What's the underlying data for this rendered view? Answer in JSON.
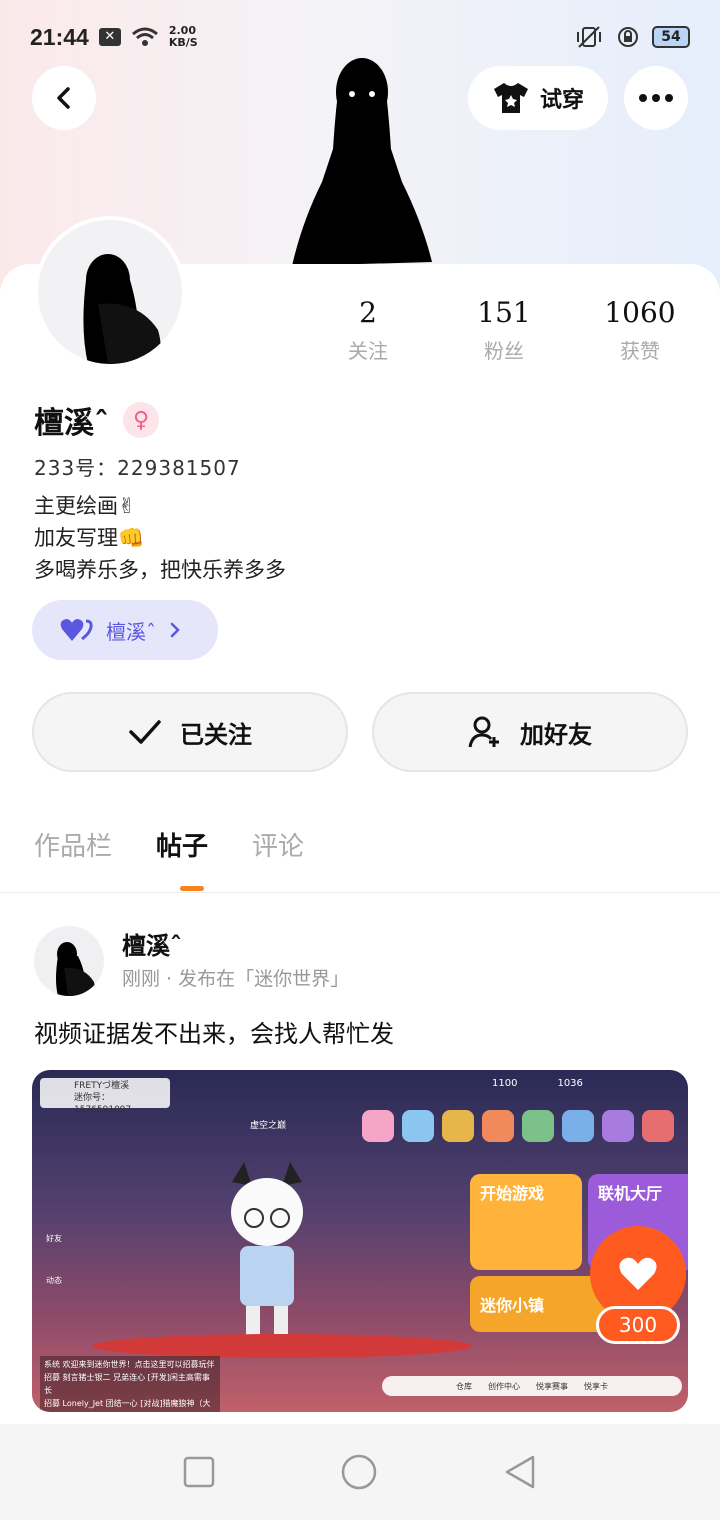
{
  "status_bar": {
    "time": "21:44",
    "sim_icon": "x-box-icon",
    "network_speed_value": "2.00",
    "network_speed_unit": "KB/S",
    "battery": "54"
  },
  "header": {
    "try_on_label": "试穿"
  },
  "profile": {
    "stats": [
      {
        "value": "2",
        "label": "关注"
      },
      {
        "value": "151",
        "label": "粉丝"
      },
      {
        "value": "1060",
        "label": "获赞"
      }
    ],
    "name": "檀溪ˆ",
    "gender_symbol": "♀",
    "uid": "233号：229381507",
    "bio_lines": [
      "主更绘画✌",
      "加友写理👊",
      "多喝养乐多，把快乐养多多"
    ],
    "tag_label": "檀溪ˆ",
    "follow_label": "已关注",
    "add_friend_label": "加好友"
  },
  "tabs": [
    {
      "label": "作品栏",
      "active": false
    },
    {
      "label": "帖子",
      "active": true
    },
    {
      "label": "评论",
      "active": false
    }
  ],
  "post": {
    "author": "檀溪ˆ",
    "meta": "刚刚 · 发布在「迷你世界」",
    "text": "视频证据发不出来，会找人帮忙发",
    "like_count": "300",
    "game": {
      "player_name": "FRETYづ檀溪",
      "player_id": "迷你号：1576591097",
      "coins_a": "1100",
      "coins_b": "1036",
      "map_title": "虚空之巅",
      "start_label": "开始游戏",
      "lobby_label": "联机大厅",
      "town_label": "迷你小镇",
      "chat_lines": [
        "系统 欢迎来到迷你世界！点击这里可以招募玩伴",
        "招募 刻言猪士银二 兄弟连心 [开发]闲主高需事长",
        "招募 Lonely_Jet 团结一心 [对战]猎魔狼神（大佬"
      ],
      "bottom_items": [
        "仓库",
        "创作中心",
        "悦享赛事",
        "悦享卡"
      ],
      "side_labels": [
        "好友",
        "动态"
      ]
    }
  },
  "colors": {
    "accent": "#f58220",
    "like": "#ff5a1f",
    "tag_bg": "#e6e6fb",
    "tag_text": "#5b58e0",
    "gender": "#f0608a"
  }
}
